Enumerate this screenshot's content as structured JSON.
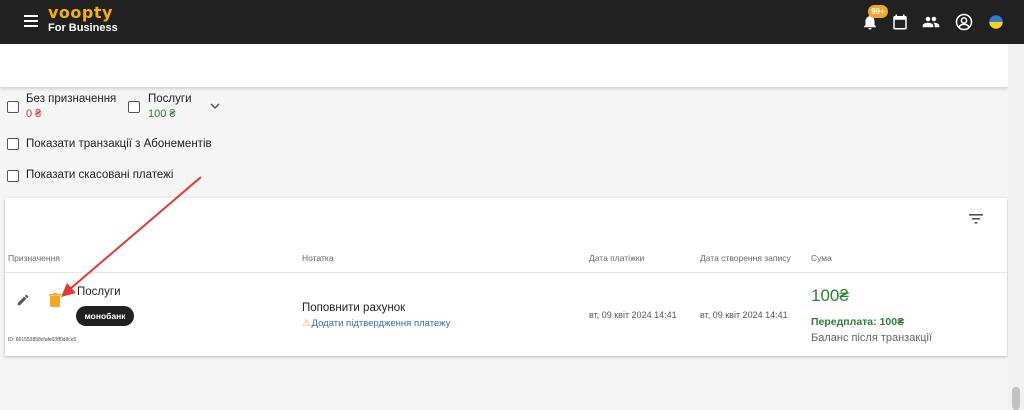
{
  "app": {
    "logo": "voopty",
    "subtitle": "For Business"
  },
  "header": {
    "notification_count": "99+"
  },
  "filters": {
    "no_purpose_label": "Без призначення",
    "no_purpose_amount": "0 ₴",
    "services_label": "Послуги",
    "services_amount": "100 ₴",
    "show_subscriptions_label": "Показати транзакції з Абонементів",
    "show_cancelled_label": "Показати скасовані платежі"
  },
  "table": {
    "columns": [
      "Призначення",
      "Нотатка",
      "Дата платіжки",
      "Дата створення запису",
      "Сума"
    ],
    "rows": [
      {
        "purpose": "Послуги",
        "bank_chip": "монобанк",
        "id": "ID: 661553858cfafe03ff0d8ce5",
        "note": "Поповнити рахунок",
        "confirm_link": "Додати підтвердження платежу",
        "payment_date": "вт, 09 квіт 2024 14:41",
        "created_date": "вт, 09 квіт 2024 14:41",
        "sum": "100₴",
        "prepayment": "Передплата: 100₴",
        "balance_label": "Баланс після транзакції"
      }
    ]
  },
  "colors": {
    "accent": "#f5b300",
    "positive": "#2e7d32",
    "negative": "#d32f2f",
    "annotation": "#e53935"
  },
  "icons": [
    "menu-icon",
    "bell-icon",
    "calendar-icon",
    "people-icon",
    "account-icon",
    "flag-icon",
    "chevron-down-icon",
    "filter-icon",
    "edit-icon",
    "trash-icon",
    "warning-icon"
  ]
}
